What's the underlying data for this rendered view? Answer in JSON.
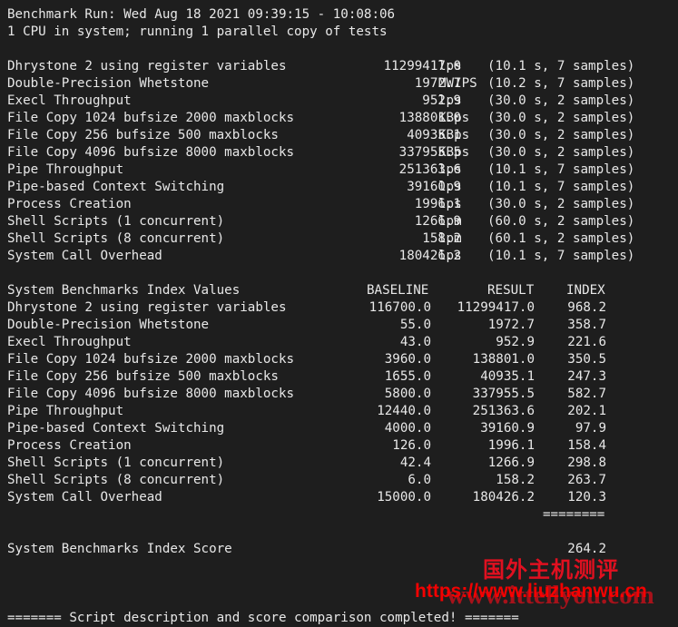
{
  "separator": "------------------------------------------------------------------------",
  "header": {
    "run_line": "Benchmark Run: Wed Aug 18 2021 09:39:15 - 10:08:06",
    "cpu_line": "1 CPU in system; running 1 parallel copy of tests"
  },
  "results": [
    {
      "name": "Dhrystone 2 using register variables",
      "value": "11299417.0",
      "unit": "lps",
      "detail": "(10.1 s, 7 samples)"
    },
    {
      "name": "Double-Precision Whetstone",
      "value": "1972.7",
      "unit": "MWIPS",
      "detail": "(10.2 s, 7 samples)"
    },
    {
      "name": "Execl Throughput",
      "value": "952.9",
      "unit": "lps",
      "detail": "(30.0 s, 2 samples)"
    },
    {
      "name": "File Copy 1024 bufsize 2000 maxblocks",
      "value": "138801.0",
      "unit": "KBps",
      "detail": "(30.0 s, 2 samples)"
    },
    {
      "name": "File Copy 256 bufsize 500 maxblocks",
      "value": "40935.1",
      "unit": "KBps",
      "detail": "(30.0 s, 2 samples)"
    },
    {
      "name": "File Copy 4096 bufsize 8000 maxblocks",
      "value": "337955.5",
      "unit": "KBps",
      "detail": "(30.0 s, 2 samples)"
    },
    {
      "name": "Pipe Throughput",
      "value": "251363.6",
      "unit": "lps",
      "detail": "(10.1 s, 7 samples)"
    },
    {
      "name": "Pipe-based Context Switching",
      "value": "39160.9",
      "unit": "lps",
      "detail": "(10.1 s, 7 samples)"
    },
    {
      "name": "Process Creation",
      "value": "1996.1",
      "unit": "lps",
      "detail": "(30.0 s, 2 samples)"
    },
    {
      "name": "Shell Scripts (1 concurrent)",
      "value": "1266.9",
      "unit": "lpm",
      "detail": "(60.0 s, 2 samples)"
    },
    {
      "name": "Shell Scripts (8 concurrent)",
      "value": "158.2",
      "unit": "lpm",
      "detail": "(60.1 s, 2 samples)"
    },
    {
      "name": "System Call Overhead",
      "value": "180426.2",
      "unit": "lps",
      "detail": "(10.1 s, 7 samples)"
    }
  ],
  "index_table": {
    "title": "System Benchmarks Index Values",
    "columns": [
      "BASELINE",
      "RESULT",
      "INDEX"
    ],
    "rows": [
      {
        "name": "Dhrystone 2 using register variables",
        "baseline": "116700.0",
        "result": "11299417.0",
        "index": "968.2"
      },
      {
        "name": "Double-Precision Whetstone",
        "baseline": "55.0",
        "result": "1972.7",
        "index": "358.7"
      },
      {
        "name": "Execl Throughput",
        "baseline": "43.0",
        "result": "952.9",
        "index": "221.6"
      },
      {
        "name": "File Copy 1024 bufsize 2000 maxblocks",
        "baseline": "3960.0",
        "result": "138801.0",
        "index": "350.5"
      },
      {
        "name": "File Copy 256 bufsize 500 maxblocks",
        "baseline": "1655.0",
        "result": "40935.1",
        "index": "247.3"
      },
      {
        "name": "File Copy 4096 bufsize 8000 maxblocks",
        "baseline": "5800.0",
        "result": "337955.5",
        "index": "582.7"
      },
      {
        "name": "Pipe Throughput",
        "baseline": "12440.0",
        "result": "251363.6",
        "index": "202.1"
      },
      {
        "name": "Pipe-based Context Switching",
        "baseline": "4000.0",
        "result": "39160.9",
        "index": "97.9"
      },
      {
        "name": "Process Creation",
        "baseline": "126.0",
        "result": "1996.1",
        "index": "158.4"
      },
      {
        "name": "Shell Scripts (1 concurrent)",
        "baseline": "42.4",
        "result": "1266.9",
        "index": "298.8"
      },
      {
        "name": "Shell Scripts (8 concurrent)",
        "baseline": "6.0",
        "result": "158.2",
        "index": "263.7"
      },
      {
        "name": "System Call Overhead",
        "baseline": "15000.0",
        "result": "180426.2",
        "index": "120.3"
      }
    ],
    "rule": "========",
    "score_label": "System Benchmarks Index Score",
    "score": "264.2"
  },
  "footer": "======= Script description and score comparison completed! =======",
  "watermarks": {
    "title_cn": "国外主机测评",
    "url1": "https://www.liuzhanwu.cn",
    "url2": "www.ittellyou.com"
  }
}
